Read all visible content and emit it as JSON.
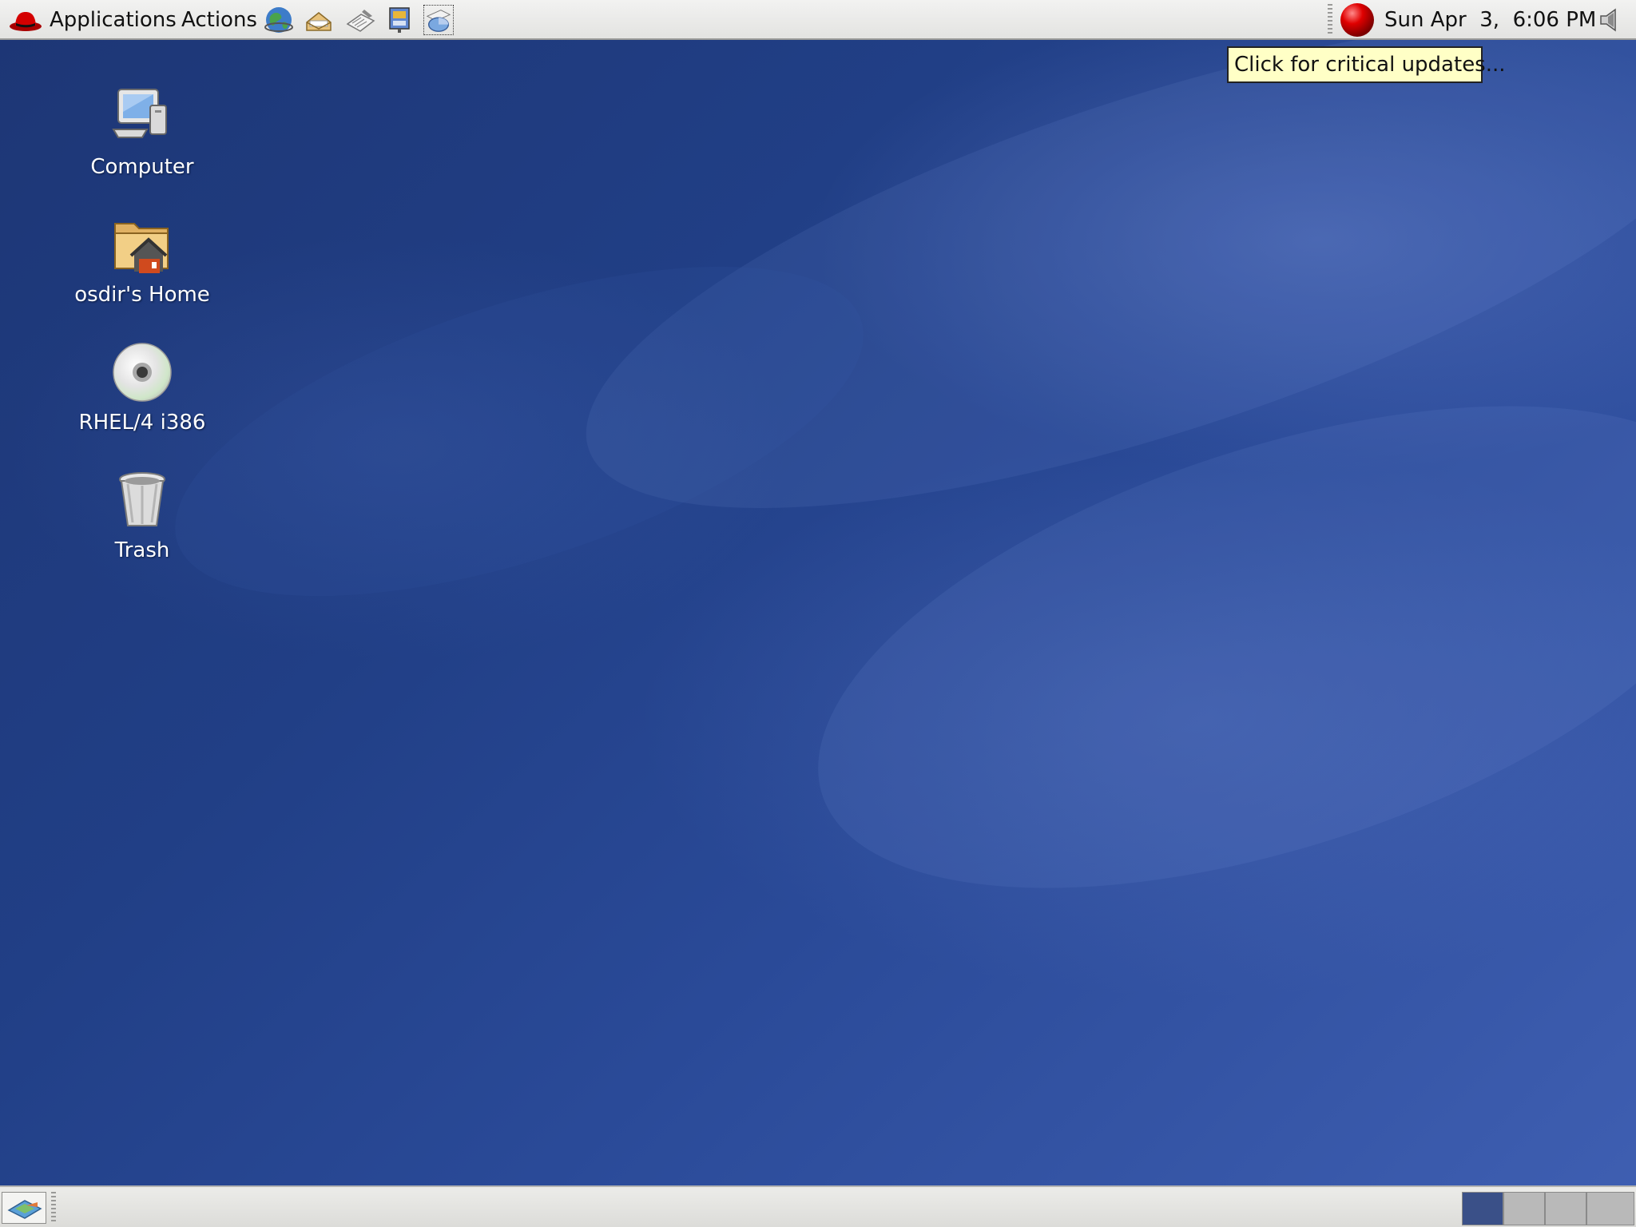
{
  "top_panel": {
    "menu_applications": "Applications",
    "menu_actions": "Actions",
    "launchers": [
      "web-browser-icon",
      "email-icon",
      "office-writer-icon",
      "office-presentation-icon",
      "office-calc-icon"
    ],
    "clock": "Sun Apr  3,  6:06 PM",
    "update_status_color": "#cc0000"
  },
  "tooltip": {
    "text": "Click for critical updates..."
  },
  "desktop": {
    "icons": [
      {
        "label": "Computer"
      },
      {
        "label": "osdir's Home"
      },
      {
        "label": "RHEL/4 i386"
      },
      {
        "label": "Trash"
      }
    ]
  },
  "bottom_panel": {
    "workspaces": 4,
    "active_workspace": 1
  },
  "colors": {
    "panel": "#e8e8e6",
    "desktop": "#22418a",
    "tooltip": "#ffffc6"
  }
}
